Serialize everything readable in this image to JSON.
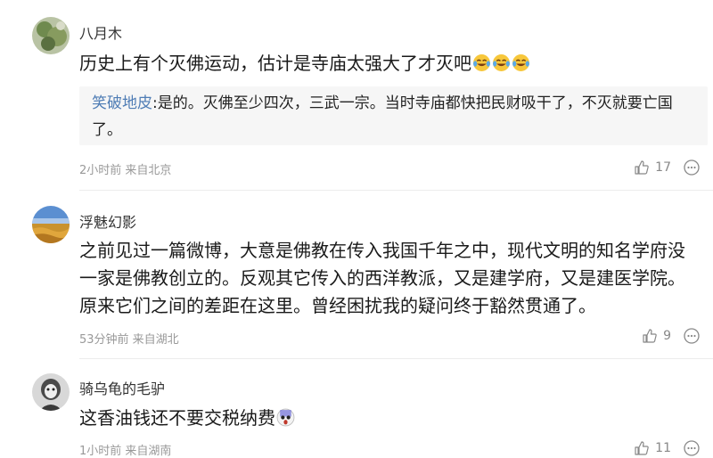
{
  "comments": [
    {
      "username": "八月木",
      "content": "历史上有个灭佛运动，估计是寺庙太强大了才灭吧",
      "emojis": [
        "laugh-cry-icon",
        "laugh-cry-icon",
        "laugh-cry-icon"
      ],
      "reply": {
        "user": "笑破地皮",
        "text": ":是的。灭佛至少四次，三武一宗。当时寺庙都快把民财吸干了，不灭就要亡国了。"
      },
      "meta": "2小时前 来自北京",
      "likes": "17"
    },
    {
      "username": "浮魅幻影",
      "content": "之前见过一篇微博，大意是佛教在传入我国千年之中，现代文明的知名学府没一家是佛教创立的。反观其它传入的西洋教派，又是建学府，又是建医学院。原来它们之间的差距在这里。曾经困扰我的疑问终于豁然贯通了。",
      "meta": "53分钟前 来自湖北",
      "likes": "9"
    },
    {
      "username": "骑乌龟的毛驴",
      "content": "这香油钱还不要交税纳费",
      "emojis": [
        "scared-face-icon"
      ],
      "meta": "1小时前 来自湖南",
      "likes": "11"
    }
  ]
}
